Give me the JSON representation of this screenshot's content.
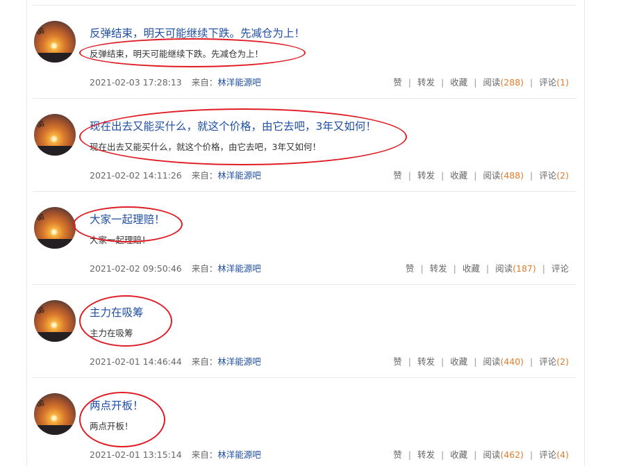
{
  "posts": [
    {
      "title": "反弹结束，明天可能继续下跌。先减仓为上！",
      "excerpt": "反弹结束，明天可能继续下跌。先减仓为上！",
      "date": "2021-02-03 17:28:13",
      "source_label": "来自：",
      "source_link": "林洋能源吧",
      "actions": {
        "like": "赞",
        "forward": "转发",
        "favorite": "收藏",
        "read": "阅读",
        "read_count": "(288)",
        "comment": "评论",
        "comment_count": "(1)"
      }
    },
    {
      "title": "现在出去又能买什么，就这个价格，由它去吧，3年又如何！",
      "excerpt": "现在出去又能买什么，就这个价格，由它去吧，3年又如何！",
      "date": "2021-02-02 14:11:26",
      "source_label": "来自：",
      "source_link": "林洋能源吧",
      "actions": {
        "like": "赞",
        "forward": "转发",
        "favorite": "收藏",
        "read": "阅读",
        "read_count": "(488)",
        "comment": "评论",
        "comment_count": "(2)"
      }
    },
    {
      "title": "大家一起理赔！",
      "excerpt": "大家一起理赔！",
      "date": "2021-02-02 09:50:46",
      "source_label": "来自：",
      "source_link": "林洋能源吧",
      "actions": {
        "like": "赞",
        "forward": "转发",
        "favorite": "收藏",
        "read": "阅读",
        "read_count": "(187)",
        "comment": "评论",
        "comment_count": ""
      }
    },
    {
      "title": "主力在吸筹",
      "excerpt": "主力在吸筹",
      "date": "2021-02-01 14:46:44",
      "source_label": "来自：",
      "source_link": "林洋能源吧",
      "actions": {
        "like": "赞",
        "forward": "转发",
        "favorite": "收藏",
        "read": "阅读",
        "read_count": "(440)",
        "comment": "评论",
        "comment_count": "(2)"
      }
    },
    {
      "title": "两点开板！",
      "excerpt": "两点开板！",
      "date": "2021-02-01 13:15:14",
      "source_label": "来自：",
      "source_link": "林洋能源吧",
      "actions": {
        "like": "赞",
        "forward": "转发",
        "favorite": "收藏",
        "read": "阅读",
        "read_count": "(462)",
        "comment": "评论",
        "comment_count": "(4)"
      }
    }
  ],
  "colors": {
    "title": "#1f4ea3",
    "count": "#e07b2b",
    "annotation": "#e01b24"
  },
  "icons": {
    "avatar": "sunset-avatar-icon"
  }
}
